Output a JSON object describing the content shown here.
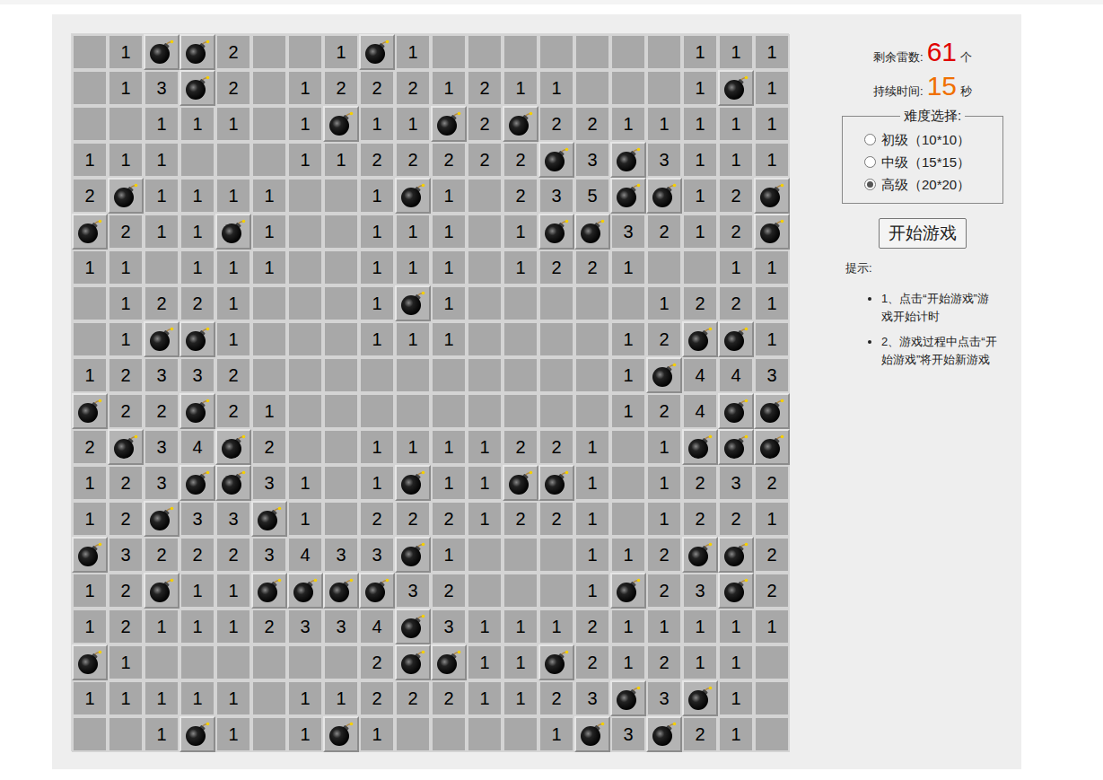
{
  "board": {
    "rows": [
      [
        "",
        "1",
        {
          "kind": "mine"
        },
        {
          "kind": "mine"
        },
        "2",
        "",
        "",
        "1",
        {
          "kind": "mine"
        },
        "1",
        "",
        "",
        "",
        "",
        "",
        "",
        "",
        "1",
        "1",
        "1"
      ],
      [
        "",
        "1",
        "3",
        {
          "kind": "mine"
        },
        "2",
        "",
        "1",
        "2",
        "2",
        "2",
        "1",
        "2",
        "1",
        "1",
        "",
        "",
        "",
        "1",
        {
          "kind": "mine"
        },
        "1"
      ],
      [
        "",
        "",
        "1",
        "1",
        "1",
        "",
        "1",
        {
          "kind": "mine"
        },
        "1",
        "1",
        {
          "kind": "mine"
        },
        "2",
        {
          "kind": "mine"
        },
        "2",
        "2",
        "1",
        "1",
        "1",
        "1",
        "1"
      ],
      [
        "1",
        "1",
        "1",
        "",
        "",
        "",
        "1",
        "1",
        "2",
        "2",
        "2",
        "2",
        "2",
        {
          "kind": "mine"
        },
        "3",
        {
          "kind": "mine"
        },
        "3",
        "1",
        "1",
        "1"
      ],
      [
        "2",
        {
          "kind": "mine"
        },
        "1",
        "1",
        "1",
        "1",
        "",
        "",
        "1",
        {
          "kind": "mine"
        },
        "1",
        "",
        "2",
        "3",
        "5",
        {
          "kind": "mine"
        },
        {
          "kind": "mine"
        },
        "1",
        "2",
        {
          "kind": "mine"
        }
      ],
      [
        {
          "kind": "mine"
        },
        "2",
        "1",
        "1",
        {
          "kind": "mine"
        },
        "1",
        "",
        "",
        "1",
        "1",
        "1",
        "",
        "1",
        {
          "kind": "mine"
        },
        {
          "kind": "mine"
        },
        "3",
        "2",
        "1",
        "2",
        {
          "kind": "mine"
        }
      ],
      [
        "1",
        "1",
        "",
        "1",
        "1",
        "1",
        "",
        "",
        "1",
        "1",
        "1",
        "",
        "1",
        "2",
        "2",
        "1",
        "",
        "",
        "1",
        "1"
      ],
      [
        "",
        "1",
        "2",
        "2",
        "1",
        "",
        "",
        "",
        "1",
        {
          "kind": "mine"
        },
        "1",
        "",
        "",
        "",
        "",
        "",
        "1",
        "2",
        "2",
        "1"
      ],
      [
        "",
        "1",
        {
          "kind": "mine"
        },
        {
          "kind": "mine"
        },
        "1",
        "",
        "",
        "",
        "1",
        "1",
        "1",
        "",
        "",
        "",
        "",
        "1",
        "2",
        {
          "kind": "mine"
        },
        {
          "kind": "mine"
        },
        "1"
      ],
      [
        "1",
        "2",
        "3",
        "3",
        "2",
        "",
        "",
        "",
        "",
        "",
        "",
        "",
        "",
        "",
        "",
        "1",
        {
          "kind": "mine"
        },
        "4",
        "4",
        "3"
      ],
      [
        {
          "kind": "mine"
        },
        "2",
        "2",
        {
          "kind": "mine"
        },
        "2",
        "1",
        "",
        "",
        "",
        "",
        "",
        "",
        "",
        "",
        "",
        "1",
        "2",
        "4",
        {
          "kind": "mine"
        },
        {
          "kind": "mine"
        }
      ],
      [
        "2",
        {
          "kind": "mine"
        },
        "3",
        "4",
        {
          "kind": "mine"
        },
        "2",
        "",
        "",
        "1",
        "1",
        "1",
        "1",
        "2",
        "2",
        "1",
        "",
        "1",
        {
          "kind": "mine"
        },
        {
          "kind": "mine"
        },
        {
          "kind": "mine"
        }
      ],
      [
        "1",
        "2",
        "3",
        {
          "kind": "mine"
        },
        {
          "kind": "mine"
        },
        "3",
        "1",
        "",
        "1",
        {
          "kind": "mine"
        },
        "1",
        "1",
        {
          "kind": "mine"
        },
        {
          "kind": "mine"
        },
        "1",
        "",
        "1",
        "2",
        "3",
        "2"
      ],
      [
        "1",
        "2",
        {
          "kind": "mine"
        },
        "3",
        "3",
        {
          "kind": "mine"
        },
        "1",
        "",
        "2",
        "2",
        "2",
        "1",
        "2",
        "2",
        "1",
        "",
        "1",
        "2",
        "2",
        "1"
      ],
      [
        {
          "kind": "mine"
        },
        "3",
        "2",
        "2",
        "2",
        "3",
        "4",
        "3",
        "3",
        {
          "kind": "mine"
        },
        "1",
        "",
        "",
        "",
        "1",
        "1",
        "2",
        {
          "kind": "mine"
        },
        {
          "kind": "mine"
        },
        "2"
      ],
      [
        "1",
        "2",
        {
          "kind": "mine"
        },
        "1",
        "1",
        {
          "kind": "mine"
        },
        {
          "kind": "mine"
        },
        {
          "kind": "mine"
        },
        {
          "kind": "mine"
        },
        "3",
        "2",
        "",
        "",
        "",
        "1",
        {
          "kind": "mine"
        },
        "2",
        "3",
        {
          "kind": "mine"
        },
        "2"
      ],
      [
        "1",
        "2",
        "1",
        "1",
        "1",
        "2",
        "3",
        "3",
        "4",
        {
          "kind": "mine"
        },
        "3",
        "1",
        "1",
        "1",
        "2",
        "1",
        "1",
        "1",
        "1",
        "1"
      ],
      [
        {
          "kind": "mine"
        },
        "1",
        "",
        "",
        "",
        "",
        "",
        "",
        "2",
        {
          "kind": "mine"
        },
        {
          "kind": "mine"
        },
        "1",
        "1",
        {
          "kind": "mine"
        },
        "2",
        "1",
        "2",
        "1",
        "1",
        ""
      ],
      [
        "1",
        "1",
        "1",
        "1",
        "1",
        "",
        "1",
        "1",
        "2",
        "2",
        "2",
        "1",
        "1",
        "2",
        "3",
        {
          "kind": "mine"
        },
        "3",
        {
          "kind": "mine"
        },
        "1",
        ""
      ],
      [
        "",
        "",
        "1",
        {
          "kind": "mine"
        },
        "1",
        "",
        "1",
        {
          "kind": "mine"
        },
        "1",
        "",
        "",
        "",
        "",
        "1",
        {
          "kind": "mine"
        },
        "3",
        {
          "kind": "mine"
        },
        "2",
        "1",
        ""
      ]
    ]
  },
  "mines_left": {
    "label": "剩余雷数:",
    "value": "61",
    "unit": "个"
  },
  "time": {
    "label": "持续时间:",
    "value": "15",
    "unit": "秒"
  },
  "difficulty": {
    "legend": "难度选择:",
    "options": [
      {
        "label": "初级（10*10）",
        "selected": false
      },
      {
        "label": "中级（15*15）",
        "selected": false
      },
      {
        "label": "高级（20*20）",
        "selected": true
      }
    ]
  },
  "start_button": "开始游戏",
  "tips": {
    "title": "提示:",
    "items": [
      "1、点击“开始游戏”游戏开始计时",
      "2、游戏过程中点击“开始游戏”将开始新游戏"
    ]
  }
}
